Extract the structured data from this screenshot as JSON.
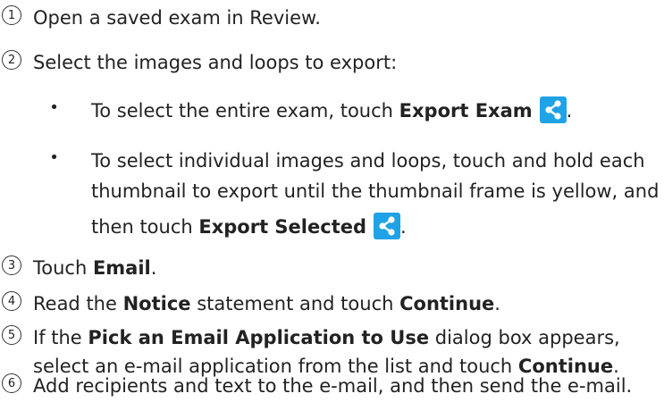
{
  "steps": [
    {
      "number": "1",
      "text": "Open a saved exam in Review."
    },
    {
      "number": "2",
      "text": "Select the images and loops to export:"
    },
    {
      "number": "3",
      "text_prefix": "Touch ",
      "bold": "Email",
      "text_suffix": "."
    },
    {
      "number": "4",
      "text_prefix": "Read the ",
      "bold1": "Notice",
      "text_mid": " statement and touch ",
      "bold2": "Continue",
      "text_suffix": "."
    },
    {
      "number": "5",
      "line1_prefix": "If the ",
      "line1_bold": "Pick an Email Application to Use",
      "line1_suffix": " dialog box appears,",
      "line2_prefix": "select an e-mail application from the list and touch ",
      "line2_bold": "Continue",
      "line2_suffix": "."
    },
    {
      "number": "6",
      "text": "Add recipients and text to the e-mail, and then send the e-mail."
    }
  ],
  "bullets": [
    {
      "marker": "•",
      "prefix": "To select the entire exam, touch ",
      "bold": "Export Exam",
      "suffix": ".",
      "icon": "share-icon"
    },
    {
      "marker": "•",
      "line1": "To select individual images and loops, touch and hold each",
      "line2": "thumbnail to export until the thumbnail frame is yellow, and",
      "line3_prefix": "then touch ",
      "line3_bold": "Export Selected",
      "line3_suffix": ".",
      "icon": "share-icon"
    }
  ],
  "colors": {
    "text": "#222222",
    "share_icon_bg": "#1fa2e6"
  }
}
